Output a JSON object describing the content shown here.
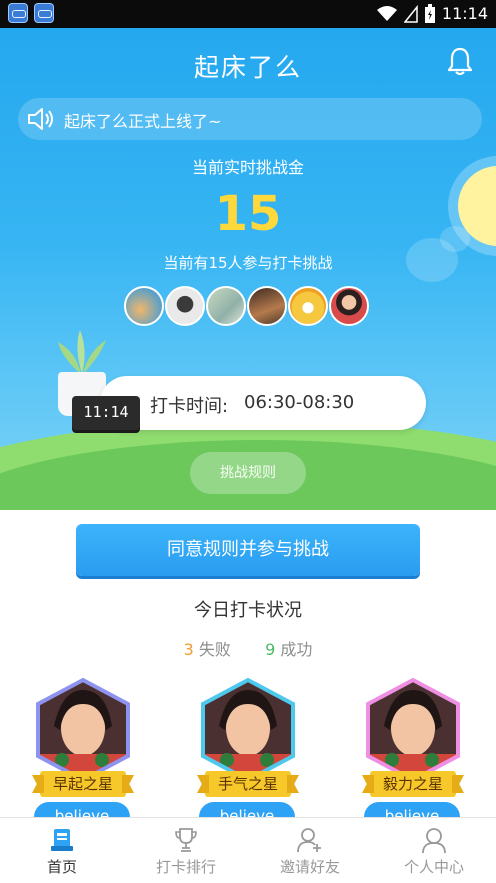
{
  "status_bar": {
    "time": "11:14"
  },
  "header": {
    "title": "起床了么"
  },
  "notice": {
    "text": "起床了么正式上线了~"
  },
  "challenge": {
    "pot_label": "当前实时挑战金",
    "pot_amount": "15",
    "participants_text": "当前有15人参与打卡挑战"
  },
  "checkin": {
    "clock_display": "11:14",
    "label": "打卡时间:",
    "range": "06:30-08:30"
  },
  "rules_button": {
    "label": "挑战规则"
  },
  "join_button": {
    "label": "同意规则并参与挑战"
  },
  "today": {
    "title": "今日打卡状况",
    "fail_count": "3",
    "fail_label": "失败",
    "success_count": "9",
    "success_label": "成功"
  },
  "stars": [
    {
      "title": "早起之星",
      "name": "believe",
      "frame_color": "#8e93f0"
    },
    {
      "title": "手气之星",
      "name": "believe",
      "frame_color": "#4fc8ee"
    },
    {
      "title": "毅力之星",
      "name": "believe",
      "frame_color": "#ef8fe3"
    }
  ],
  "nav": [
    {
      "label": "首页",
      "icon": "home-icon",
      "active": true
    },
    {
      "label": "打卡排行",
      "icon": "trophy-icon",
      "active": false
    },
    {
      "label": "邀请好友",
      "icon": "add-friend-icon",
      "active": false
    },
    {
      "label": "个人中心",
      "icon": "profile-icon",
      "active": false
    }
  ],
  "colors": {
    "primary": "#2ea3f5",
    "amount": "#ffd83b",
    "fail": "#f29b38",
    "success": "#4cbc63"
  }
}
